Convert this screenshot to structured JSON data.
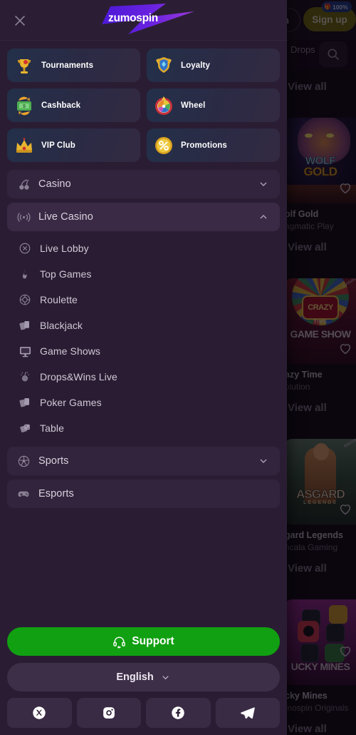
{
  "drawer": {
    "close_icon": "close-icon",
    "logo_text": "zumospin",
    "logo_accent": "#5b21d6",
    "promo_tiles": [
      {
        "label": "Tournaments",
        "icon": "trophy-icon"
      },
      {
        "label": "Loyalty",
        "icon": "shield-gem-icon"
      },
      {
        "label": "Cashback",
        "icon": "money-refresh-icon"
      },
      {
        "label": "Wheel",
        "icon": "wheel-of-fortune-icon"
      },
      {
        "label": "VIP Club",
        "icon": "crown-icon"
      },
      {
        "label": "Promotions",
        "icon": "percent-coin-icon"
      }
    ],
    "nav": [
      {
        "label": "Casino",
        "icon": "cherries-icon",
        "expandable": true,
        "expanded": false,
        "chevron": "chevron-down-icon"
      },
      {
        "label": "Live Casino",
        "icon": "broadcast-icon",
        "expandable": true,
        "expanded": true,
        "chevron": "chevron-up-icon"
      }
    ],
    "live_casino_children": [
      {
        "label": "Live Lobby",
        "icon": "circle-x-icon"
      },
      {
        "label": "Top Games",
        "icon": "flame-icon"
      },
      {
        "label": "Roulette",
        "icon": "roulette-wheel-icon"
      },
      {
        "label": "Blackjack",
        "icon": "playing-cards-icon"
      },
      {
        "label": "Game Shows",
        "icon": "monitor-icon"
      },
      {
        "label": "Drops&Wins Live",
        "icon": "drops-wins-icon"
      },
      {
        "label": "Poker Games",
        "icon": "playing-cards-icon"
      },
      {
        "label": "Table",
        "icon": "dice-icon"
      }
    ],
    "nav_after": [
      {
        "label": "Sports",
        "icon": "soccer-ball-icon",
        "expandable": true,
        "expanded": false,
        "chevron": "chevron-down-icon"
      },
      {
        "label": "Esports",
        "icon": "gamepad-icon",
        "expandable": false,
        "chevron": ""
      }
    ],
    "support": {
      "label": "Support",
      "icon": "headset-icon",
      "color": "#11a011"
    },
    "language": {
      "label": "English",
      "chevron": "chevron-down-icon"
    },
    "socials": [
      {
        "name": "x-twitter-icon"
      },
      {
        "name": "instagram-icon"
      },
      {
        "name": "facebook-icon"
      },
      {
        "name": "telegram-icon"
      }
    ]
  },
  "background_page": {
    "login_label": "n",
    "signup_label": "Sign up",
    "bonus_badge": "100%",
    "bonus_badge_icon": "gift-icon",
    "chip_label": "Drops",
    "search_icon": "search-icon",
    "view_all_label": "View all",
    "cards": [
      {
        "title": "olf Gold",
        "full_title": "Wolf Gold",
        "provider": "agmatic Play",
        "full_provider": "Pragmatic Play",
        "art_title_1": "WOLF",
        "art_title_2": "GOLD"
      },
      {
        "title": "azy Time",
        "full_title": "Crazy Time",
        "provider": "olution",
        "full_provider": "Evolution",
        "art_title_1": "CRAZY",
        "art_title_2": "TIME",
        "art_title_3": "GAME SHOW",
        "provider_tag": "evolution"
      },
      {
        "title": "gard Legends",
        "full_title": "Asgard Legends",
        "provider": "ncala Gaming",
        "full_provider": "Mancala Gaming",
        "art_title_1": "ASGARD",
        "art_title_2": "LEGENDS",
        "provider_tag": "Mancala"
      },
      {
        "title": "cky Mines",
        "full_title": "Lucky Mines",
        "provider": "mospin Originals",
        "full_provider": "Zumospin Originals",
        "art_title_1": "UCKY MINES"
      }
    ]
  }
}
